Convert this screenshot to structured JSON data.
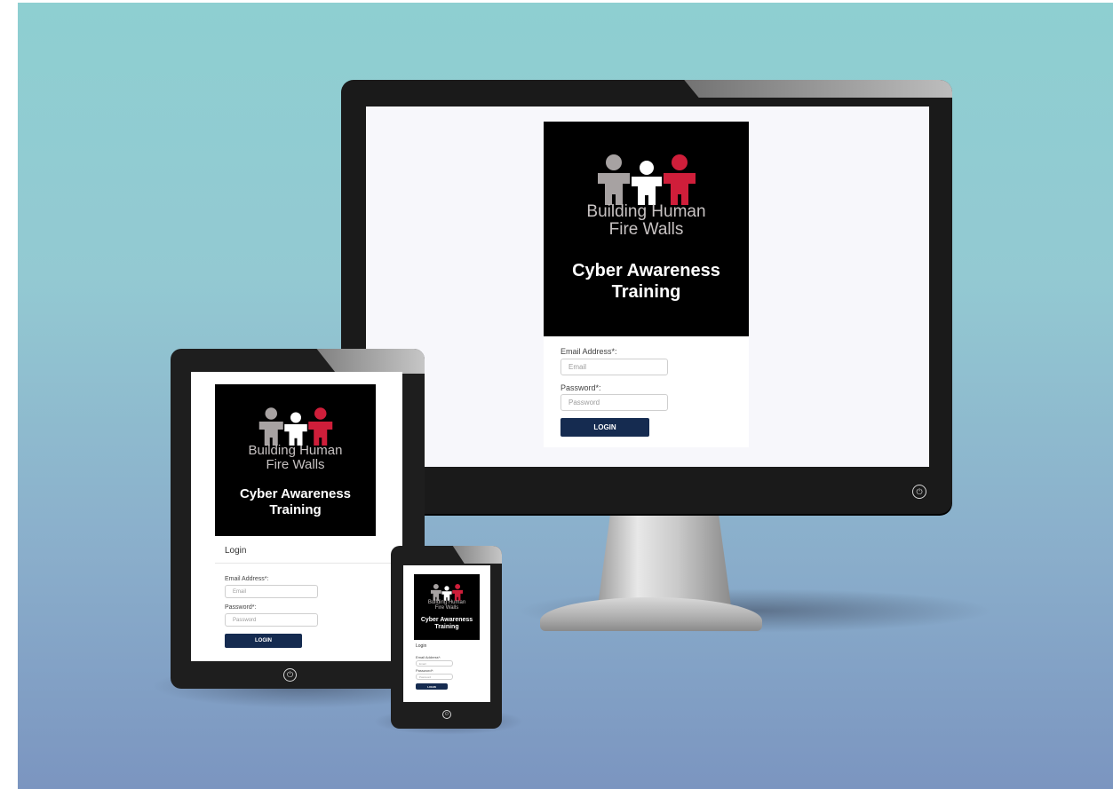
{
  "brand": {
    "name_line1": "Building Human",
    "name_line2": "Fire Walls",
    "title_line1": "Cyber Awareness",
    "title_line2": "Training",
    "logo_colors": {
      "left": "#a7a2a2",
      "middle": "#ffffff",
      "right": "#cf1e3a"
    },
    "background": "#000000"
  },
  "login": {
    "heading": "Login",
    "email_label": "Email Address*:",
    "email_placeholder": "Email",
    "password_label": "Password*:",
    "password_placeholder": "Password",
    "button_label": "LOGIN",
    "button_color": "#152b50"
  },
  "devices": {
    "monitor": {
      "power_icon": "power-icon"
    },
    "tablet": {
      "power_icon": "power-icon"
    },
    "phone": {
      "power_icon": "power-icon"
    }
  }
}
